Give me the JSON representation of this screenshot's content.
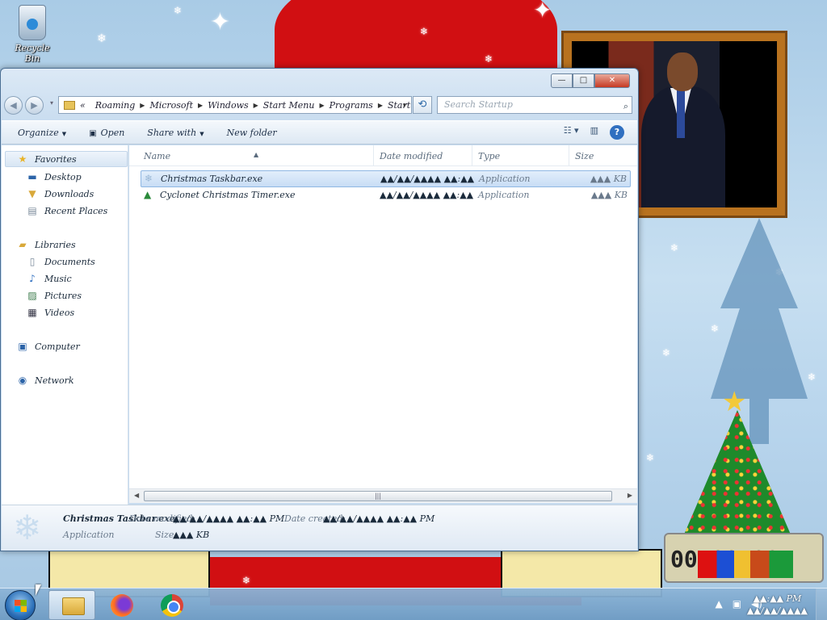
{
  "desktop": {
    "recycle_bin_label": "Recycle Bin"
  },
  "window": {
    "caption": {
      "minimize": "—",
      "maximize": "□",
      "close": "✕"
    },
    "nav": {
      "back": "◀",
      "forward": "▶",
      "recent": "▾"
    },
    "address": {
      "overflow": "«",
      "crumbs": [
        "Roaming",
        "Microsoft",
        "Windows",
        "Start Menu",
        "Programs",
        "Startup"
      ],
      "dropdown": "▾"
    },
    "refresh_icon": "refresh-icon",
    "search_placeholder": "Search Startup",
    "toolbar": {
      "organize": "Organize",
      "open": "Open",
      "share_with": "Share with",
      "new_folder": "New folder"
    },
    "sidebar": {
      "favorites": "Favorites",
      "favorites_items": [
        "Desktop",
        "Downloads",
        "Recent Places"
      ],
      "libraries": "Libraries",
      "libraries_items": [
        "Documents",
        "Music",
        "Pictures",
        "Videos"
      ],
      "computer": "Computer",
      "network": "Network"
    },
    "columns": {
      "name": "Name",
      "date_modified": "Date modified",
      "type": "Type",
      "size": "Size"
    },
    "files": [
      {
        "name": "Christmas Taskbar.exe",
        "date": "▲▲/▲▲/▲▲▲▲ ▲▲:▲▲",
        "type": "Application",
        "size": "▲▲▲ KB",
        "icon": "snowflake-icon"
      },
      {
        "name": "Cyclonet Christmas Timer.exe",
        "date": "▲▲/▲▲/▲▲▲▲ ▲▲:▲▲",
        "type": "Application",
        "size": "▲▲▲ KB",
        "icon": "xmas-tree-icon"
      }
    ],
    "scroll_grip": "|||",
    "details": {
      "filename": "Christmas Taskbar.exe",
      "date_modified_label": "Date modified:",
      "date_modified_value": "▲▲/▲▲/▲▲▲▲ ▲▲:▲▲ PM",
      "date_created_label": "Date created:",
      "date_created_value": "▲▲/▲▲/▲▲▲▲ ▲▲:▲▲ PM",
      "type": "Application",
      "size_label": "Size:",
      "size_value": "▲▲▲ KB"
    }
  },
  "taskbar": {
    "apps": [
      "Windows Explorer",
      "Firefox",
      "Google Chrome"
    ],
    "clock_time": "▲▲:▲▲ PM",
    "clock_date": "▲▲/▲▲/▲▲▲▲"
  },
  "colors": {
    "accent": "#2f6fc0",
    "close": "#c73a23",
    "selection": "#c8ddf5"
  }
}
